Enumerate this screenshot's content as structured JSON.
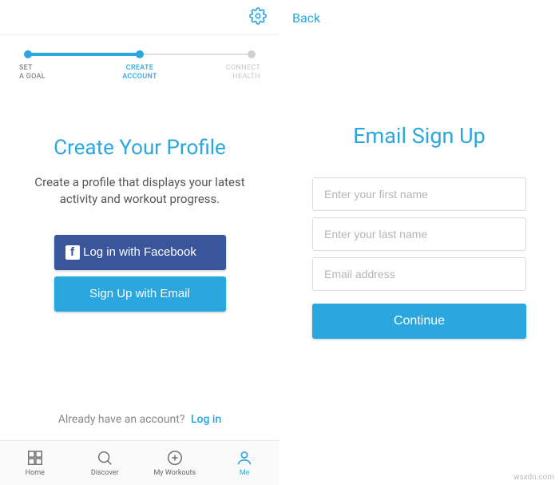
{
  "left": {
    "stepper": {
      "step1": "SET\nA GOAL",
      "step2": "CREATE\nACCOUNT",
      "step3": "CONNECT\nHEALTH"
    },
    "title": "Create Your Profile",
    "subtitle": "Create a profile that displays your latest activity and workout progress.",
    "fb_button": "Log in with Facebook",
    "email_button": "Sign Up with Email",
    "already_text": "Already have an account?",
    "login_link": "Log in",
    "tabs": {
      "home": "Home",
      "discover": "Discover",
      "workouts": "My Workouts",
      "me": "Me"
    }
  },
  "right": {
    "back": "Back",
    "title": "Email Sign Up",
    "first_placeholder": "Enter your first name",
    "last_placeholder": "Enter your last name",
    "email_placeholder": "Email address",
    "continue": "Continue"
  },
  "watermark": "wsxdn.com"
}
